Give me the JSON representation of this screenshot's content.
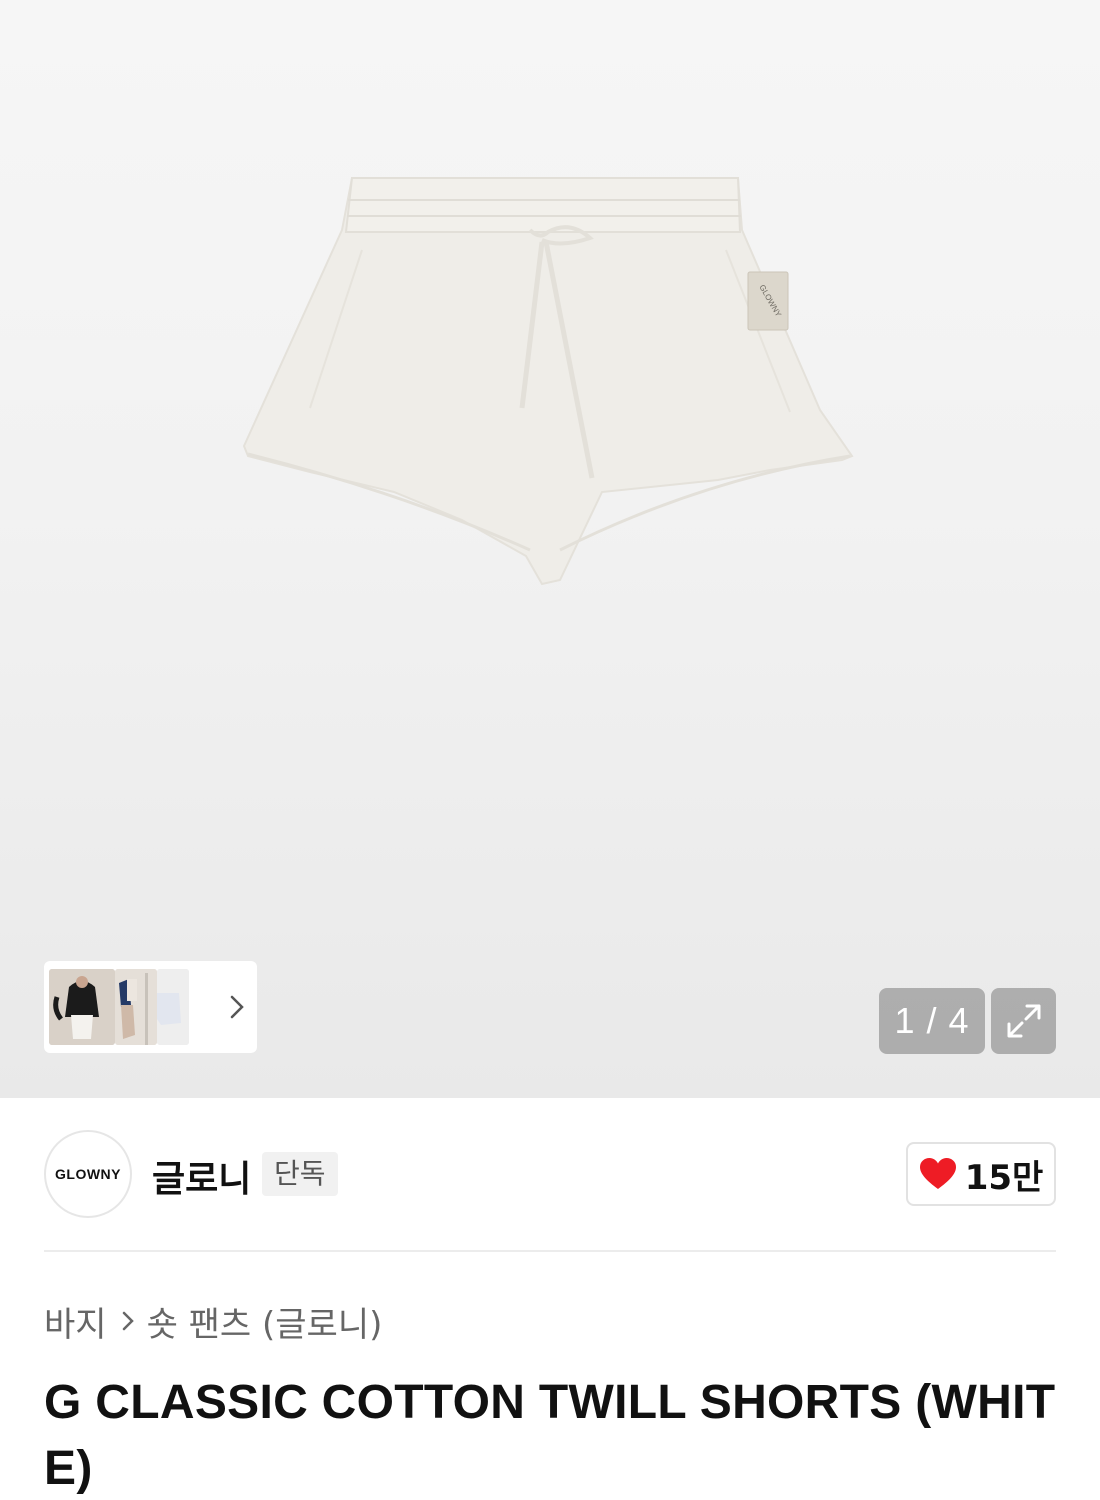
{
  "gallery": {
    "current_page": 1,
    "total_pages": 4,
    "pager_text": "1 / 4",
    "product_label_text": "GLOWNY"
  },
  "brand": {
    "logo_text": "GLOWNY",
    "name": "글로니",
    "badge": "단독",
    "like_count": "15만",
    "heart_color": "#ee1c25"
  },
  "breadcrumb": {
    "items": [
      "바지",
      "숏 팬츠 (글로니)"
    ]
  },
  "product": {
    "title": "G CLASSIC COTTON TWILL SHORTS (WHITE)"
  },
  "icons": {
    "thumb_next": "chevron-right-icon",
    "fullscreen": "expand-arrows-icon",
    "like": "heart-icon",
    "crumb_separator": "chevron-right-icon"
  }
}
